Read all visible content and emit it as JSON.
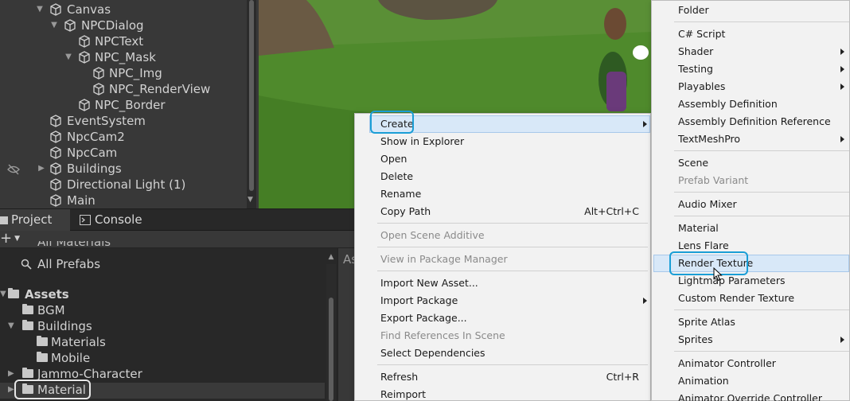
{
  "hierarchy": {
    "items": [
      {
        "label": "Canvas"
      },
      {
        "label": "NPCDialog"
      },
      {
        "label": "NPCText"
      },
      {
        "label": "NPC_Mask"
      },
      {
        "label": "NPC_Img"
      },
      {
        "label": "NPC_RenderView"
      },
      {
        "label": "NPC_Border"
      },
      {
        "label": "EventSystem"
      },
      {
        "label": "NpcCam2"
      },
      {
        "label": "NpcCam"
      },
      {
        "label": "Buildings"
      },
      {
        "label": "Directional Light (1)"
      },
      {
        "label": "Main"
      }
    ]
  },
  "tabs": {
    "project": "Project",
    "console": "Console"
  },
  "toolbar": {
    "add": "+"
  },
  "project": {
    "favorites": [
      "All Materials",
      "All Prefabs"
    ],
    "assets_label": "Assets",
    "folders": [
      "BGM",
      "Buildings",
      "Materials",
      "Mobile",
      "Jammo-Character",
      "Material"
    ],
    "right_header": "As"
  },
  "menu_main": {
    "items": [
      {
        "label": "Create"
      },
      {
        "label": "Show in Explorer"
      },
      {
        "label": "Open"
      },
      {
        "label": "Delete"
      },
      {
        "label": "Rename"
      },
      {
        "label": "Copy Path",
        "shortcut": "Alt+Ctrl+C"
      },
      {
        "label": "Open Scene Additive"
      },
      {
        "label": "View in Package Manager"
      },
      {
        "label": "Import New Asset..."
      },
      {
        "label": "Import Package"
      },
      {
        "label": "Export Package..."
      },
      {
        "label": "Find References In Scene"
      },
      {
        "label": "Select Dependencies"
      },
      {
        "label": "Refresh",
        "shortcut": "Ctrl+R"
      },
      {
        "label": "Reimport"
      }
    ]
  },
  "menu_create": {
    "items": [
      {
        "label": "Folder"
      },
      {
        "label": "C# Script"
      },
      {
        "label": "Shader"
      },
      {
        "label": "Testing"
      },
      {
        "label": "Playables"
      },
      {
        "label": "Assembly Definition"
      },
      {
        "label": "Assembly Definition Reference"
      },
      {
        "label": "TextMeshPro"
      },
      {
        "label": "Scene"
      },
      {
        "label": "Prefab Variant"
      },
      {
        "label": "Audio Mixer"
      },
      {
        "label": "Material"
      },
      {
        "label": "Lens Flare"
      },
      {
        "label": "Render Texture"
      },
      {
        "label": "Lightmap Parameters"
      },
      {
        "label": "Custom Render Texture"
      },
      {
        "label": "Sprite Atlas"
      },
      {
        "label": "Sprites"
      },
      {
        "label": "Animator Controller"
      },
      {
        "label": "Animation"
      },
      {
        "label": "Animator Override Controller"
      }
    ]
  },
  "colors": {
    "callout": "#1a9ed6",
    "highlight": "#d8e8f8",
    "panel": "#383838"
  }
}
